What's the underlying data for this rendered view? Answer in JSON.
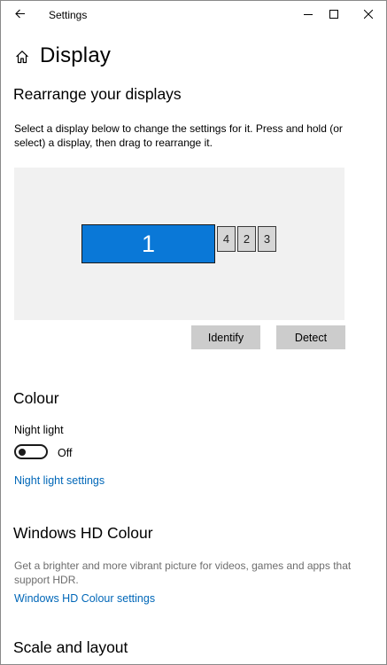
{
  "window": {
    "app_title": "Settings",
    "back_icon": "arrow-left",
    "minimize_icon": "minimize",
    "maximize_icon": "maximize",
    "close_icon": "close"
  },
  "page": {
    "title": "Display",
    "home_icon": "home"
  },
  "rearrange": {
    "title": "Rearrange your displays",
    "description": "Select a display below to change the settings for it. Press and hold (or select) a display, then drag to rearrange it.",
    "displays": [
      {
        "id": "1",
        "selected": true
      },
      {
        "id": "4",
        "selected": false
      },
      {
        "id": "2",
        "selected": false
      },
      {
        "id": "3",
        "selected": false
      }
    ],
    "identify_label": "Identify",
    "detect_label": "Detect"
  },
  "colour": {
    "title": "Colour",
    "night_light_label": "Night light",
    "night_light_state": "Off",
    "night_light_on": false,
    "night_light_settings_link": "Night light settings"
  },
  "hd_colour": {
    "title": "Windows HD Colour",
    "description": "Get a brighter and more vibrant picture for videos, games and apps that support HDR.",
    "settings_link": "Windows HD Colour settings"
  },
  "scale": {
    "title": "Scale and layout"
  },
  "colors": {
    "accent": "#0a78d7",
    "link": "#0067b8",
    "button_bg": "#cccccc",
    "display_area_bg": "#f1f1f1"
  }
}
